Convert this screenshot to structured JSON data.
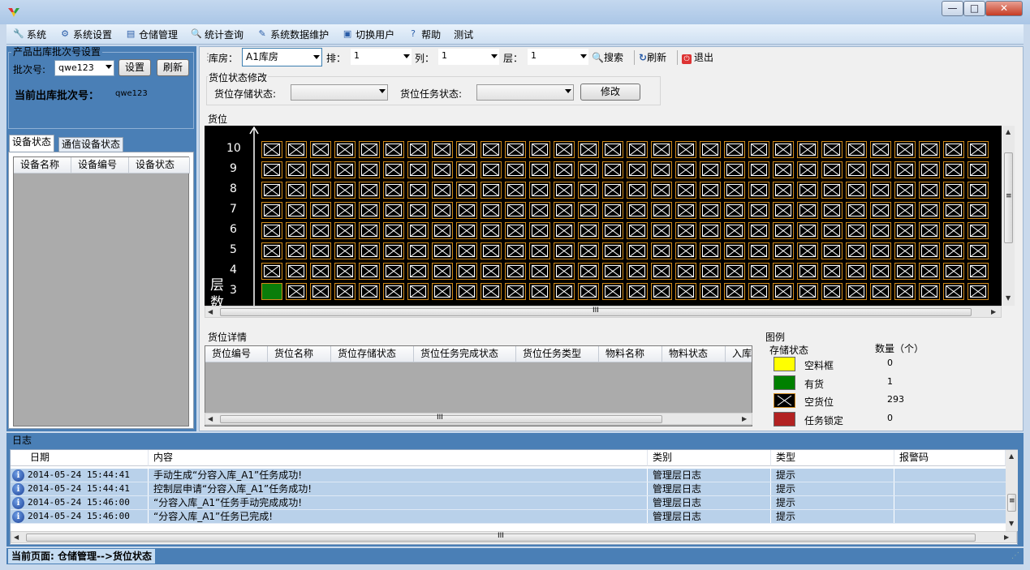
{
  "window": {
    "minimize": "—",
    "maximize": "□",
    "close": "✕"
  },
  "menu": [
    {
      "label": "系统",
      "icon": "wrench-icon",
      "glyph": "🔧"
    },
    {
      "label": "系统设置",
      "icon": "gear-icon",
      "glyph": "⚙"
    },
    {
      "label": "仓储管理",
      "icon": "warehouse-icon",
      "glyph": "▤"
    },
    {
      "label": "统计查询",
      "icon": "magnifier-icon",
      "glyph": "🔍"
    },
    {
      "label": "系统数据维护",
      "icon": "tools-icon",
      "glyph": "✎"
    },
    {
      "label": "切换用户",
      "icon": "switch-user-icon",
      "glyph": "▣"
    },
    {
      "label": "帮助",
      "icon": "help-icon",
      "glyph": "?"
    },
    {
      "label": "测试",
      "icon": "",
      "glyph": ""
    }
  ],
  "batch": {
    "group_title": "产品出库批次号设置",
    "batch_label": "批次号:",
    "batch_value": "qwe123",
    "set_button": "设置",
    "refresh_button": "刷新",
    "current_label": "当前出库批次号：",
    "current_value": "qwe123"
  },
  "device_tabs": [
    "设备状态",
    "通信设备状态"
  ],
  "device_columns": [
    "设备名称",
    "设备编号",
    "设备状态"
  ],
  "toolbar": {
    "warehouse_label": "库房：",
    "warehouse_value": "A1库房",
    "row_label": "排：",
    "row_value": "1",
    "col_label": "列：",
    "col_value": "1",
    "layer_label": "层：",
    "layer_value": "1",
    "search": "搜索",
    "refresh": "刷新",
    "exit": "退出"
  },
  "modify": {
    "group_title": "货位状态修改",
    "storage_label": "货位存储状态:",
    "storage_value": "",
    "task_label": "货位任务状态:",
    "task_value": "",
    "modify_button": "修改"
  },
  "rack": {
    "group_title": "货位",
    "layer_axis_label": "层数",
    "visible_layers": [
      10,
      9,
      8,
      7,
      6,
      5,
      4,
      3
    ],
    "visible_columns": 30,
    "filled_cells": [
      {
        "layer": 3,
        "column": 1
      }
    ]
  },
  "details": {
    "group_title": "货位详情",
    "columns": [
      "货位编号",
      "货位名称",
      "货位存储状态",
      "货位任务完成状态",
      "货位任务类型",
      "物料名称",
      "物料状态",
      "入库"
    ]
  },
  "legend": {
    "group_title": "图例",
    "storage_header": "存储状态",
    "count_header": "数量（个）",
    "items": [
      {
        "label": "空料框",
        "count": "0",
        "color": "#ffff00"
      },
      {
        "label": "有货",
        "count": "1",
        "color": "#008000"
      },
      {
        "label": "空货位",
        "count": "293",
        "color": "#000000"
      },
      {
        "label": "任务锁定",
        "count": "0",
        "color": "#b22222"
      }
    ]
  },
  "log": {
    "group_title": "日志",
    "columns": [
      "日期",
      "内容",
      "类别",
      "类型",
      "报警码"
    ],
    "rows": [
      {
        "date": "2014-05-24 15:44:41",
        "content": "手动生成“分容入库_A1”任务成功!",
        "category": "管理层日志",
        "type": "提示",
        "code": ""
      },
      {
        "date": "2014-05-24 15:44:41",
        "content": "控制层申请“分容入库_A1”任务成功!",
        "category": "管理层日志",
        "type": "提示",
        "code": ""
      },
      {
        "date": "2014-05-24 15:46:00",
        "content": "“分容入库_A1”任务手动完成成功!",
        "category": "管理层日志",
        "type": "提示",
        "code": ""
      },
      {
        "date": "2014-05-24 15:46:00",
        "content": "“分容入库_A1”任务已完成!",
        "category": "管理层日志",
        "type": "提示",
        "code": ""
      }
    ]
  },
  "status": {
    "text": "当前页面:  仓储管理-->货位状态"
  },
  "scroll": {
    "h_glyph": "III",
    "v_glyph": "≡"
  }
}
